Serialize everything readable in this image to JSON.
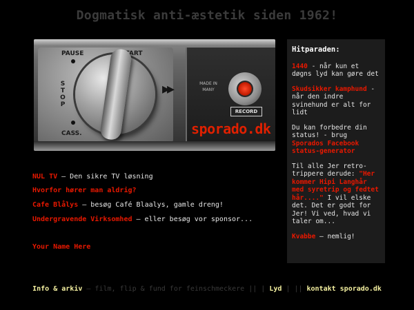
{
  "site_title": "Dogmatisk anti-æstetik siden 1962!",
  "hero": {
    "labels": {
      "pause": "PAUSE",
      "start": "START",
      "stop": "STOP",
      "cass": "CASS.",
      "made_in": "MADE IN",
      "country": "MANY",
      "record": "RECORD",
      "brand": "sporado.dk"
    },
    "arrows": "▸▸"
  },
  "links": [
    {
      "title": "NUL TV",
      "desc": " – Den sikre TV løsning"
    },
    {
      "title": "Hvorfor hører man aldrig?",
      "desc": ""
    },
    {
      "title": "Cafe Blålys",
      "desc": " – besøg Café Blaalys, gamle dreng!"
    },
    {
      "title": "Undergravende Virksomhed",
      "desc": " – eller besøg vor sponsor..."
    },
    {
      "title": "Your Name Here",
      "desc": ""
    }
  ],
  "sidebar": {
    "heading": "Hitparaden:",
    "items": [
      {
        "link": "1440",
        "text": " - når kun et døgns lyd kan gøre det"
      },
      {
        "link": "Skudsikker kamphund",
        "text": " - når den indre svinehund er alt for lidt"
      },
      {
        "prefix": "Du kan forbedre din status! - brug ",
        "link": "Sporados Facebook status-generator",
        "text": ""
      },
      {
        "prefix": "Til alle Jer retro-trippere derude: ",
        "link": "\"Her kommer Hipi Langhår med syretrip og fedtet hår....\"",
        "text": " I vil elske det. Det er godt for Jer! Vi ved, hvad vi taler om..."
      },
      {
        "link": "Kvabbe",
        "text": " – nemlig!"
      }
    ]
  },
  "footer": {
    "info": "Info & arkiv",
    "tagline": " – film, flip & fund for feinschmeckere || | ",
    "lyd": "Lyd",
    "sep": " | || ",
    "contact": "kontakt sporado.dk"
  },
  "colors": {
    "accent_red": "#e81800",
    "footer_link": "#f4f0a0",
    "sidebar_bg": "#1c1c1c"
  }
}
